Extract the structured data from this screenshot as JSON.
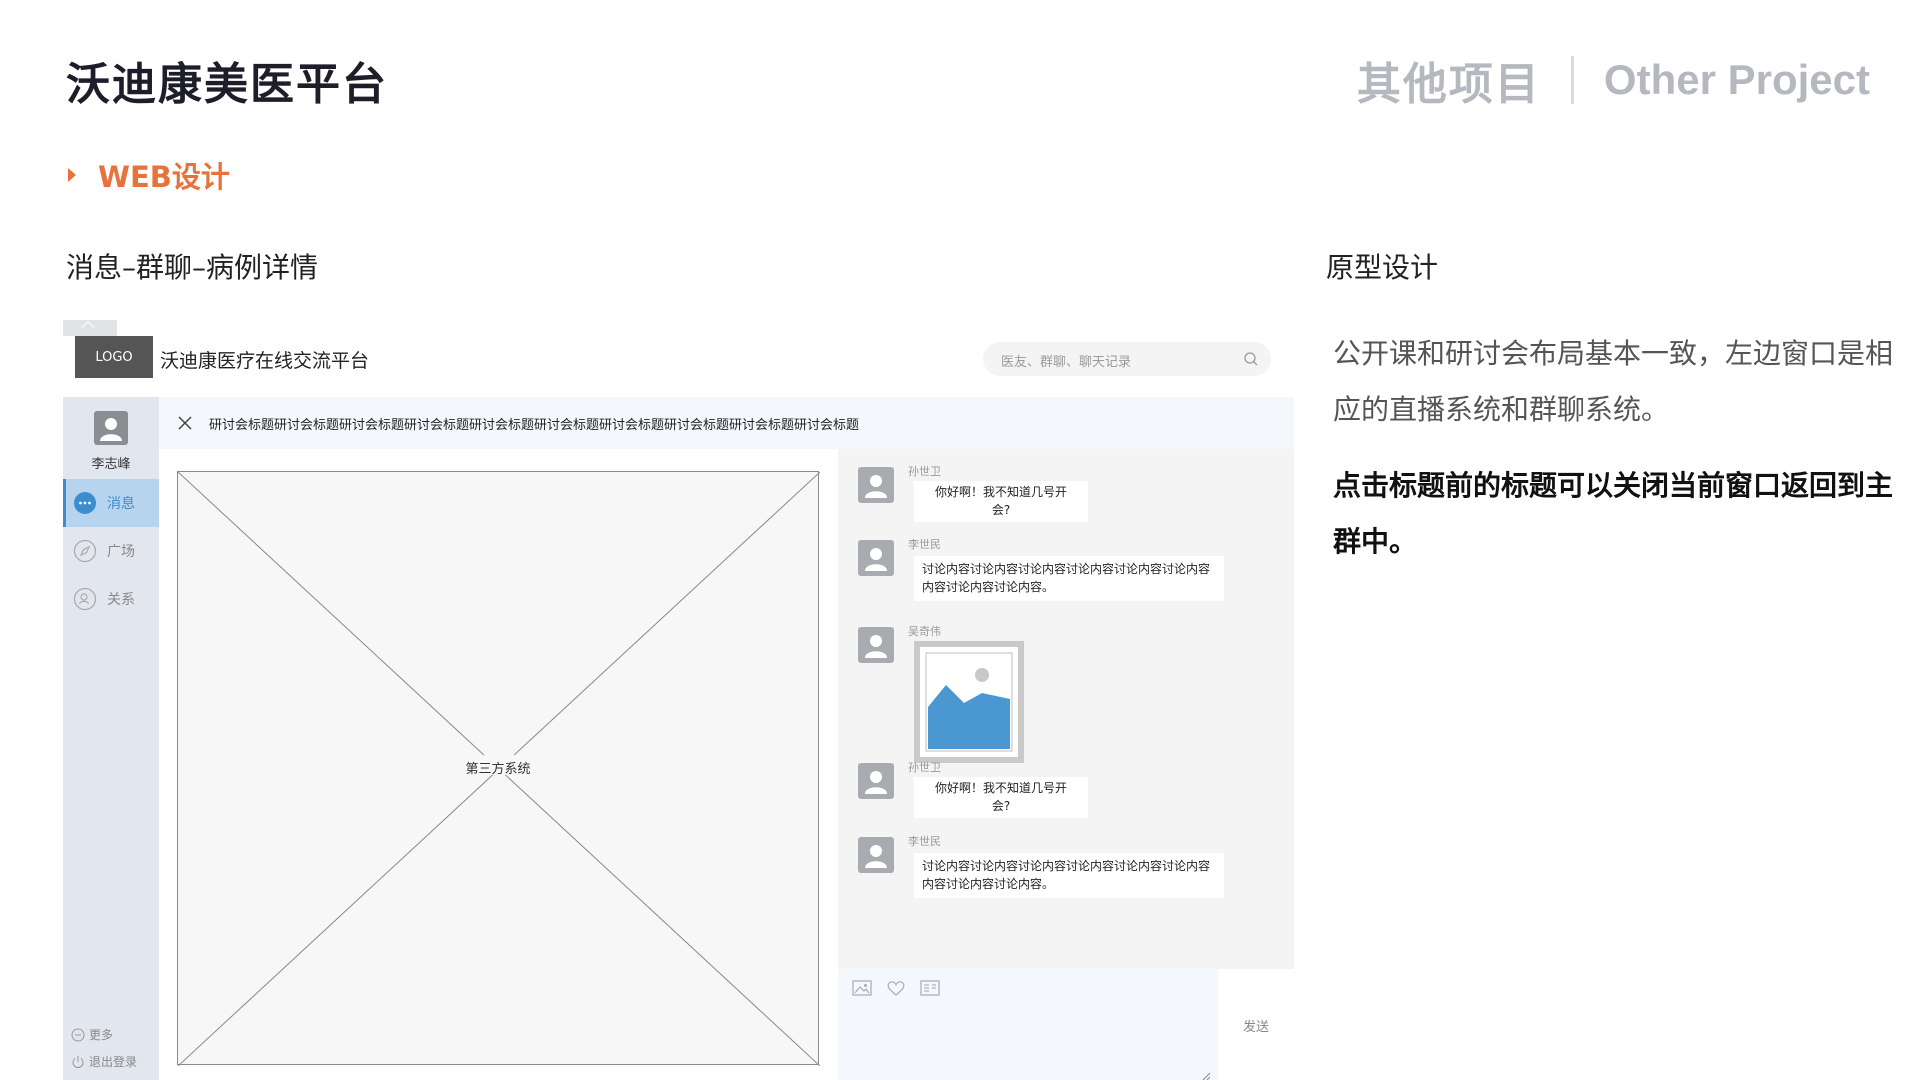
{
  "header": {
    "title": "沃迪康美医平台",
    "other_cn": "其他项目",
    "other_en": "Other Project"
  },
  "section": {
    "tag": "WEB设计"
  },
  "subtitles": {
    "left": "消息–群聊–病例详情",
    "right": "原型设计"
  },
  "description": {
    "normal": "公开课和研讨会布局基本一致，左边窗口是相应的直播系统和群聊系统。",
    "strong": "点击标题前的标题可以关闭当前窗口返回到主群中。"
  },
  "mockup": {
    "logo": "LOGO",
    "app_name": "沃迪康医疗在线交流平台",
    "search_placeholder": "医友、群聊、聊天记录",
    "sidebar": {
      "username": "李志峰",
      "items": [
        {
          "label": "消息",
          "icon": "chat-icon",
          "active": true
        },
        {
          "label": "广场",
          "icon": "compass-icon",
          "active": false
        },
        {
          "label": "关系",
          "icon": "contacts-icon",
          "active": false
        }
      ],
      "more": "更多",
      "logout": "退出登录"
    },
    "window_title": "研讨会标题研讨会标题研讨会标题研讨会标题研讨会标题研讨会标题研讨会标题研讨会标题研讨会标题研讨会标题",
    "placeholder_label": "第三方系统",
    "messages": [
      {
        "name": "孙世卫",
        "line1": "你好啊！我不知道几号开",
        "line2": "会?"
      },
      {
        "name": "李世民",
        "line1": "讨论内容讨论内容讨论内容讨论内容讨论内容讨论内容",
        "line2": "内容讨论内容讨论内容。"
      },
      {
        "name": "吴奇伟",
        "type": "image"
      },
      {
        "name": "孙世卫",
        "line1": "你好啊！我不知道几号开",
        "line2": "会?"
      },
      {
        "name": "李世民",
        "line1": "讨论内容讨论内容讨论内容讨论内容讨论内容讨论内容",
        "line2": "内容讨论内容讨论内容。"
      }
    ],
    "send_label": "发送"
  },
  "colors": {
    "accent": "#e7733c",
    "active_nav": "#3c8dcf",
    "muted_header": "#b5b8bf"
  }
}
